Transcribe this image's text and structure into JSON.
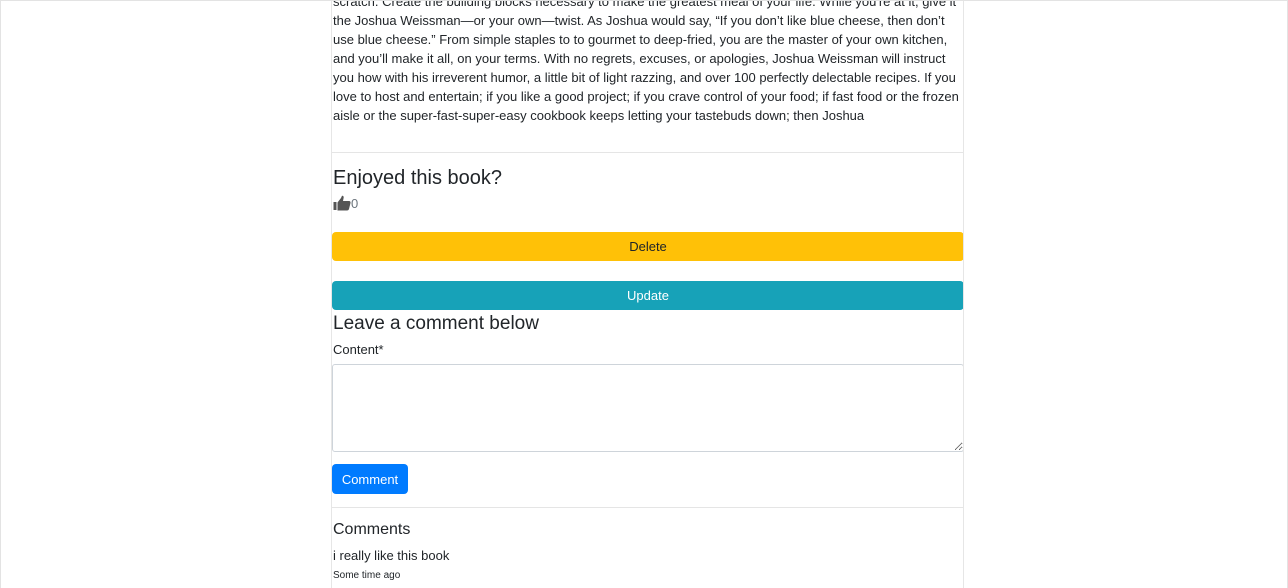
{
  "book": {
    "description": "scratch. Create the building blocks necessary to make the greatest meal of your life. While you're at it, give it the Joshua Weissman—or your own—twist. As Joshua would say, “If you don’t like blue cheese, then don’t use blue cheese.” From simple staples to to gourmet to deep-fried, you are the master of your own kitchen, and you’ll make it all, on your terms. With no regrets, excuses, or apologies, Joshua Weissman will instruct you how with his irreverent humor, a little bit of light razzing, and over 100 perfectly delectable recipes. If you love to host and entertain; if you like a good project; if you crave control of your food; if fast food or the frozen aisle or the super-fast-super-easy cookbook keeps letting your tastebuds down; then Joshua"
  },
  "likes": {
    "heading": "Enjoyed this book?",
    "icon": "thumbs-up-icon",
    "count": "0"
  },
  "actions": {
    "delete_label": "Delete",
    "update_label": "Update",
    "delete_color": "#ffc107",
    "update_color": "#17a2b8"
  },
  "comment_form": {
    "heading": "Leave a comment below",
    "content_label": "Content*",
    "content_value": "",
    "submit_label": "Comment",
    "submit_color": "#007bff"
  },
  "comments": {
    "heading": "Comments",
    "items": [
      {
        "text": "i really like this book",
        "time": "Some time ago"
      }
    ]
  }
}
